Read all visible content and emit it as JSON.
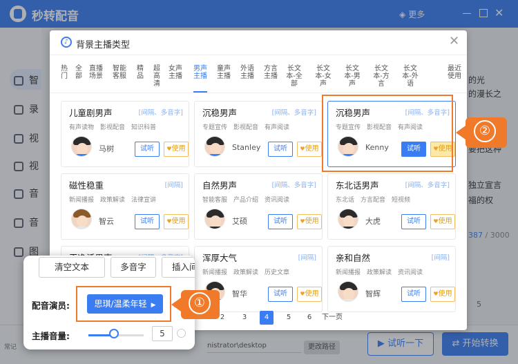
{
  "app": {
    "title": "秒转配音",
    "more_label": "更多"
  },
  "sidebar": {
    "items": [
      {
        "label": "智",
        "icon": "smart-icon"
      },
      {
        "label": "录",
        "icon": "record-icon"
      },
      {
        "label": "视",
        "icon": "video-icon"
      },
      {
        "label": "视",
        "icon": "video2-icon"
      },
      {
        "label": "音",
        "icon": "audio-icon"
      },
      {
        "label": "音",
        "icon": "audio2-icon"
      },
      {
        "label": "图",
        "icon": "image-icon"
      }
    ]
  },
  "background_text": {
    "lines": [
      "最近",
      "使用",
      "的光",
      "的漫长之",
      "",
      "要把这种",
      "",
      "独立宣言",
      "福的权"
    ],
    "counter_current": "387",
    "counter_total": "/ 3000",
    "play_control": "5"
  },
  "bottom_bar": {
    "path_label": "常记",
    "path_value": "nistrator\\desktop",
    "change_path": "更改路径",
    "listen_all": "试听一下",
    "start": "开始转换"
  },
  "dialog": {
    "title": "背景主播类型",
    "tabs": [
      {
        "label": "热门",
        "active": false
      },
      {
        "label": "全部",
        "active": false
      },
      {
        "label": "直播场景",
        "active": false
      },
      {
        "label": "智能客服",
        "active": false
      },
      {
        "label": "精品",
        "active": false
      },
      {
        "label": "超高清",
        "active": false
      },
      {
        "label": "女声主播",
        "active": false
      },
      {
        "label": "男声主播",
        "active": true
      },
      {
        "label": "童声主播",
        "active": false
      },
      {
        "label": "外语主播",
        "active": false
      },
      {
        "label": "方言主播",
        "active": false
      },
      {
        "label": "长文本-全部",
        "active": false
      },
      {
        "label": "长文本-女声",
        "active": false
      },
      {
        "label": "长文本-男声",
        "active": false
      },
      {
        "label": "长文本-方言",
        "active": false
      },
      {
        "label": "长文本-外语",
        "active": false
      },
      {
        "label": "最近使用",
        "active": false
      }
    ],
    "cards": [
      {
        "name": "儿童剧男声",
        "tag": "[间隔、多音字]",
        "tags": [
          "有声读物",
          "影视配音",
          "知识科普"
        ],
        "person": "马树",
        "listen": "试听",
        "use": "使用",
        "selected": false
      },
      {
        "name": "沉稳男声",
        "tag": "[间隔、多音字]",
        "tags": [
          "专题宣传",
          "影视配音",
          "有声阅读"
        ],
        "person": "Stanley",
        "listen": "试听",
        "use": "使用",
        "selected": false
      },
      {
        "name": "沉稳男声",
        "tag": "[间隔、多音字]",
        "tags": [
          "专题宣传",
          "影视配音",
          "有声阅读"
        ],
        "person": "Kenny",
        "listen": "试听",
        "use": "使用",
        "selected": true
      },
      {
        "name": "磁性稳重",
        "tag": "[间隔]",
        "tags": [
          "新闻播报",
          "政策解读",
          "法律宣讲"
        ],
        "person": "智云",
        "listen": "试听",
        "use": "使用",
        "selected": false
      },
      {
        "name": "自然男声",
        "tag": "[间隔、多音字]",
        "tags": [
          "智能客服",
          "产品介绍",
          "资讯阅读"
        ],
        "person": "艾硕",
        "listen": "试听",
        "use": "使用",
        "selected": false
      },
      {
        "name": "东北话男声",
        "tag": "[间隔、多音字]",
        "tags": [
          "东北话",
          "方言配音",
          "短视频"
        ],
        "person": "大虎",
        "listen": "试听",
        "use": "使用",
        "selected": false
      },
      {
        "name": "干净活男声",
        "tag": "[间隔、多音字]",
        "tags": [],
        "person": "",
        "listen": "",
        "use": "",
        "selected": false
      },
      {
        "name": "浑厚大气",
        "tag": "[间隔]",
        "tags": [
          "新闻播报",
          "政策解读",
          "历史文章"
        ],
        "person": "智华",
        "listen": "试听",
        "use": "使用",
        "selected": false
      },
      {
        "name": "亲和自然",
        "tag": "[间隔]",
        "tags": [
          "新闻播报",
          "政策解读",
          "资讯阅读"
        ],
        "person": "智辉",
        "listen": "试听",
        "use": "使用",
        "selected": false
      }
    ],
    "pagination": {
      "pages": [
        "2",
        "3",
        "4",
        "5",
        "6"
      ],
      "current": "4",
      "next": "下一页"
    }
  },
  "popup": {
    "clear_text": "清空文本",
    "polyphone": "多音字",
    "insert_pause": "插入间隔",
    "actor_label": "配音演员:",
    "actor_value": "思琪/温柔年轻",
    "volume_label": "主播音量:",
    "volume_value": "5",
    "volume_level": 0.5
  },
  "annotations": {
    "badge1": "①",
    "badge2": "②",
    "color": "#f07a2a"
  },
  "colors": {
    "accent": "#3a7df2",
    "highlight": "#f07a2a",
    "use_button": "#f0c060"
  }
}
